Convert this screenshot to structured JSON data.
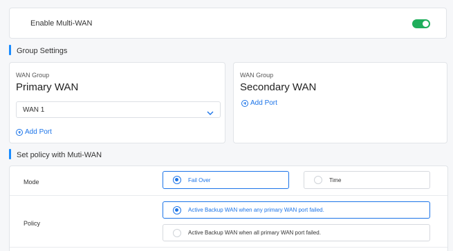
{
  "multiwan": {
    "enable_label": "Enable Multi-WAN",
    "enabled": true
  },
  "group_settings": {
    "title": "Group Settings",
    "groups": [
      {
        "sub": "WAN Group",
        "name": "Primary WAN",
        "selected_port": "WAN 1",
        "add_port_label": "Add Port"
      },
      {
        "sub": "WAN Group",
        "name": "Secondary WAN",
        "add_port_label": "Add Port"
      }
    ]
  },
  "policy": {
    "title": "Set policy with Muti-WAN",
    "mode": {
      "label": "Mode",
      "options": [
        "Fail Over",
        "Time"
      ],
      "selected": "Fail Over"
    },
    "policy_row": {
      "label": "Policy",
      "options": [
        "Active Backup WAN when any primary WAN port failed.",
        "Active Backup WAN when all primary WAN port failed."
      ],
      "selected_index": 0
    }
  },
  "colors": {
    "accent": "#1a73e8",
    "toggle_on": "#1fae5b",
    "section_bar": "#1a8cff"
  }
}
